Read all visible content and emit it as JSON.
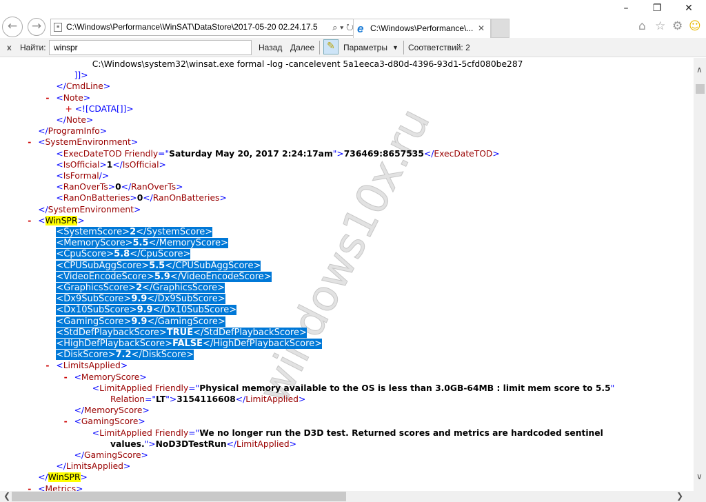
{
  "window": {
    "minimize": "–",
    "restore": "❐",
    "close": "✕"
  },
  "nav": {
    "back": "←",
    "forward": "→"
  },
  "address": {
    "value": "C:\\Windows\\Performance\\WinSAT\\DataStore\\2017-05-20 02.24.17.5",
    "controls": "⌕ ▾ ↻"
  },
  "tab": {
    "title": "C:\\Windows\\Performance\\...",
    "close": "✕"
  },
  "toolbar_icons": {
    "home": "⌂",
    "favorites": "☆",
    "settings": "⚙",
    "feedback": "☺"
  },
  "findbar": {
    "close": "x",
    "label": "Найти:",
    "query": "winspr",
    "prev": "Назад",
    "next": "Далее",
    "highlight": "✎",
    "options": "Параметры",
    "options_arrow": "▼",
    "matches": "Соответствий: 2"
  },
  "watermark": "windows10x.ru",
  "scroll": {
    "up": "∧",
    "down": "∨",
    "left": "❮",
    "right": "❯",
    "vertical_position": 0.05,
    "horizontal_visible_fraction": 0.5
  },
  "lines": [
    {
      "d": 4,
      "s": [
        [
          "k",
          "C:\\Windows\\system32\\winsat.exe formal -log -cancelevent 5a1eeca3-d80d-4396-93d1-5cfd080be287"
        ]
      ]
    },
    {
      "d": 3,
      "s": [
        [
          "b",
          "]]>"
        ]
      ]
    },
    {
      "d": 2,
      "s": [
        [
          "b",
          "</"
        ],
        [
          "t",
          "CmdLine"
        ],
        [
          "b",
          ">"
        ]
      ]
    },
    {
      "d": 2,
      "m": "-",
      "s": [
        [
          "b",
          "<"
        ],
        [
          "t",
          "Note"
        ],
        [
          "b",
          ">"
        ]
      ]
    },
    {
      "d": 2.5,
      "s": [
        [
          "plus",
          "+ "
        ],
        [
          "b",
          "<![CDATA[]]>"
        ]
      ]
    },
    {
      "d": 2,
      "s": [
        [
          "b",
          "</"
        ],
        [
          "t",
          "Note"
        ],
        [
          "b",
          ">"
        ]
      ]
    },
    {
      "d": 1,
      "s": [
        [
          "b",
          "</"
        ],
        [
          "t",
          "ProgramInfo"
        ],
        [
          "b",
          ">"
        ]
      ]
    },
    {
      "d": 1,
      "m": "-",
      "s": [
        [
          "b",
          "<"
        ],
        [
          "t",
          "SystemEnvironment"
        ],
        [
          "b",
          ">"
        ]
      ]
    },
    {
      "d": 2,
      "s": [
        [
          "b",
          "<"
        ],
        [
          "t",
          "ExecDateTOD"
        ],
        [
          "a",
          " Friendly"
        ],
        [
          "b",
          "=\""
        ],
        [
          "v",
          "Saturday May 20, 2017 2:24:17am"
        ],
        [
          "b",
          "\">"
        ],
        [
          "v",
          "736469:8657535"
        ],
        [
          "b",
          "</"
        ],
        [
          "t",
          "ExecDateTOD"
        ],
        [
          "b",
          ">"
        ]
      ]
    },
    {
      "d": 2,
      "s": [
        [
          "b",
          "<"
        ],
        [
          "t",
          "IsOfficial"
        ],
        [
          "b",
          ">"
        ],
        [
          "v",
          "1"
        ],
        [
          "b",
          "</"
        ],
        [
          "t",
          "IsOfficial"
        ],
        [
          "b",
          ">"
        ]
      ]
    },
    {
      "d": 2,
      "s": [
        [
          "b",
          "<"
        ],
        [
          "t",
          "IsFormal"
        ],
        [
          "b",
          "/>"
        ]
      ]
    },
    {
      "d": 2,
      "s": [
        [
          "b",
          "<"
        ],
        [
          "t",
          "RanOverTs"
        ],
        [
          "b",
          ">"
        ],
        [
          "v",
          "0"
        ],
        [
          "b",
          "</"
        ],
        [
          "t",
          "RanOverTs"
        ],
        [
          "b",
          ">"
        ]
      ]
    },
    {
      "d": 2,
      "s": [
        [
          "b",
          "<"
        ],
        [
          "t",
          "RanOnBatteries"
        ],
        [
          "b",
          ">"
        ],
        [
          "v",
          "0"
        ],
        [
          "b",
          "</"
        ],
        [
          "t",
          "RanOnBatteries"
        ],
        [
          "b",
          ">"
        ]
      ]
    },
    {
      "d": 1,
      "s": [
        [
          "b",
          "</"
        ],
        [
          "t",
          "SystemEnvironment"
        ],
        [
          "b",
          ">"
        ]
      ]
    },
    {
      "d": 1,
      "m": "-",
      "s": [
        [
          "b",
          "<"
        ],
        [
          "hl",
          "WinSPR"
        ],
        [
          "b",
          ">"
        ]
      ]
    },
    {
      "d": 2,
      "sel": true,
      "s": [
        [
          "s",
          "<SystemScore>"
        ],
        [
          "sb",
          "2"
        ],
        [
          "s",
          "</SystemScore>"
        ]
      ]
    },
    {
      "d": 2,
      "sel": true,
      "s": [
        [
          "s",
          "<MemoryScore>"
        ],
        [
          "sb",
          "5.5"
        ],
        [
          "s",
          "</MemoryScore>"
        ]
      ]
    },
    {
      "d": 2,
      "sel": true,
      "s": [
        [
          "s",
          "<CpuScore>"
        ],
        [
          "sb",
          "5.8"
        ],
        [
          "s",
          "</CpuScore>"
        ]
      ]
    },
    {
      "d": 2,
      "sel": true,
      "s": [
        [
          "s",
          "<CPUSubAggScore>"
        ],
        [
          "sb",
          "5.5"
        ],
        [
          "s",
          "</CPUSubAggScore>"
        ]
      ]
    },
    {
      "d": 2,
      "sel": true,
      "s": [
        [
          "s",
          "<VideoEncodeScore>"
        ],
        [
          "sb",
          "5.9"
        ],
        [
          "s",
          "</VideoEncodeScore>"
        ]
      ]
    },
    {
      "d": 2,
      "sel": true,
      "s": [
        [
          "s",
          "<GraphicsScore>"
        ],
        [
          "sb",
          "2"
        ],
        [
          "s",
          "</GraphicsScore>"
        ]
      ]
    },
    {
      "d": 2,
      "sel": true,
      "s": [
        [
          "s",
          "<Dx9SubScore>"
        ],
        [
          "sb",
          "9.9"
        ],
        [
          "s",
          "</Dx9SubScore>"
        ]
      ]
    },
    {
      "d": 2,
      "sel": true,
      "s": [
        [
          "s",
          "<Dx10SubScore>"
        ],
        [
          "sb",
          "9.9"
        ],
        [
          "s",
          "</Dx10SubScore>"
        ]
      ]
    },
    {
      "d": 2,
      "sel": true,
      "s": [
        [
          "s",
          "<GamingScore>"
        ],
        [
          "sb",
          "9.9"
        ],
        [
          "s",
          "</GamingScore>"
        ]
      ]
    },
    {
      "d": 2,
      "sel": true,
      "s": [
        [
          "s",
          "<StdDefPlaybackScore>"
        ],
        [
          "sb",
          "TRUE"
        ],
        [
          "s",
          "</StdDefPlaybackScore>"
        ]
      ]
    },
    {
      "d": 2,
      "sel": true,
      "s": [
        [
          "s",
          "<HighDefPlaybackScore>"
        ],
        [
          "sb",
          "FALSE"
        ],
        [
          "s",
          "</HighDefPlaybackScore>"
        ]
      ]
    },
    {
      "d": 2,
      "sel": true,
      "s": [
        [
          "s",
          "<DiskScore>"
        ],
        [
          "sb",
          "7.2"
        ],
        [
          "s",
          "</DiskScore>"
        ]
      ]
    },
    {
      "d": 2,
      "m": "-",
      "s": [
        [
          "b",
          "<"
        ],
        [
          "t",
          "LimitsApplied"
        ],
        [
          "b",
          ">"
        ]
      ]
    },
    {
      "d": 3,
      "m": "-",
      "s": [
        [
          "b",
          "<"
        ],
        [
          "t",
          "MemoryScore"
        ],
        [
          "b",
          ">"
        ]
      ]
    },
    {
      "d": 4,
      "s": [
        [
          "b",
          "<"
        ],
        [
          "t",
          "LimitApplied"
        ],
        [
          "a",
          " Friendly"
        ],
        [
          "b",
          "=\""
        ],
        [
          "v",
          "Physical memory available to the OS is less than 3.0GB-64MB : limit mem score to 5.5"
        ],
        [
          "b",
          "\""
        ]
      ]
    },
    {
      "d": 5,
      "s": [
        [
          "a",
          "Relation"
        ],
        [
          "b",
          "=\""
        ],
        [
          "v",
          "LT"
        ],
        [
          "b",
          "\">"
        ],
        [
          "v",
          "3154116608"
        ],
        [
          "b",
          "</"
        ],
        [
          "t",
          "LimitApplied"
        ],
        [
          "b",
          ">"
        ]
      ]
    },
    {
      "d": 3,
      "s": [
        [
          "b",
          "</"
        ],
        [
          "t",
          "MemoryScore"
        ],
        [
          "b",
          ">"
        ]
      ]
    },
    {
      "d": 3,
      "m": "-",
      "s": [
        [
          "b",
          "<"
        ],
        [
          "t",
          "GamingScore"
        ],
        [
          "b",
          ">"
        ]
      ]
    },
    {
      "d": 4,
      "s": [
        [
          "b",
          "<"
        ],
        [
          "t",
          "LimitApplied"
        ],
        [
          "a",
          " Friendly"
        ],
        [
          "b",
          "=\""
        ],
        [
          "v",
          "We no longer run the D3D test. Returned scores and metrics are hardcoded sentinel"
        ]
      ]
    },
    {
      "d": 5,
      "s": [
        [
          "v",
          "values."
        ],
        [
          "b",
          "\">"
        ],
        [
          "v",
          "NoD3DTestRun"
        ],
        [
          "b",
          "</"
        ],
        [
          "t",
          "LimitApplied"
        ],
        [
          "b",
          ">"
        ]
      ]
    },
    {
      "d": 3,
      "s": [
        [
          "b",
          "</"
        ],
        [
          "t",
          "GamingScore"
        ],
        [
          "b",
          ">"
        ]
      ]
    },
    {
      "d": 2,
      "s": [
        [
          "b",
          "</"
        ],
        [
          "t",
          "LimitsApplied"
        ],
        [
          "b",
          ">"
        ]
      ]
    },
    {
      "d": 1,
      "s": [
        [
          "b",
          "</"
        ],
        [
          "hl",
          "WinSPR"
        ],
        [
          "b",
          ">"
        ]
      ]
    },
    {
      "d": 1,
      "m": "-",
      "s": [
        [
          "b",
          "<"
        ],
        [
          "t",
          "Metrics"
        ],
        [
          "b",
          ">"
        ]
      ]
    }
  ]
}
